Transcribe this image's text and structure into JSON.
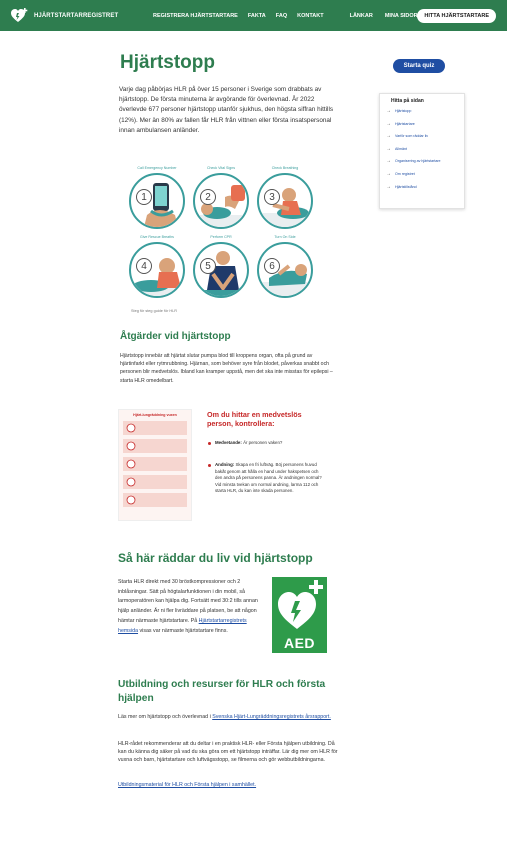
{
  "header": {
    "logo_text": "HJÄRTSTARTARREGISTRET",
    "nav": [
      "REGISTRERA HJÄRTSTARTARE",
      "FAKTA",
      "FAQ",
      "KONTAKT",
      "LÄNKAR",
      "MINA SIDOR"
    ],
    "find_button": "HITTA HJÄRTSTARTARE"
  },
  "page": {
    "title": "Hjärtstopp",
    "quiz_button": "Starta quiz",
    "intro": "Varje dag påbörjas HLR på över 15 personer i Sverige som drabbats av hjärtstopp. De första minuterna är avgörande för överlevnad. År 2022 överlevde 677 personer hjärtstopp utanför sjukhus, den högsta siffran hittills (12%). Mer än 80% av fallen får HLR från vittnen eller första insatspersonal innan ambulansen anländer."
  },
  "toc": {
    "title": "Hitta på sidan",
    "items": [
      "Hjärtstopp",
      "Hjärtstartare",
      "Varför som räddar liv",
      "Allmänt",
      "Organisering av hjärtstartare",
      "Om registret",
      "Hjärtstillstånd"
    ]
  },
  "steps": {
    "items": [
      {
        "label": "Call Emergency Number",
        "num": "1"
      },
      {
        "label": "Check Vital Signs",
        "num": "2"
      },
      {
        "label": "Check Breathing",
        "num": "3"
      },
      {
        "label": "Give Rescue Breaths",
        "num": "4"
      },
      {
        "label": "Perform CPR",
        "num": "5"
      },
      {
        "label": "Turn On Side",
        "num": "6"
      }
    ],
    "caption": "Steg för steg guide för HLR"
  },
  "section1": {
    "heading": "Åtgärder vid hjärtstopp",
    "text": "Hjärtstopp innebär att hjärtat slutar pumpa blod till kroppens organ, ofta på grund av hjärtinfarkt eller rytmrubbning. Hjärnan, som behöver syre från blodet, påverkas snabbt och personen blir medvetslös. Ibland kan kramper uppstå, men det ska inte misstas för epilepsi – starta HLR omedelbart."
  },
  "check": {
    "poster_title": "Hjärt-lungräddning vuxen",
    "title": "Om du hittar en medvetslös person, kontrollera:",
    "bullets": [
      {
        "label": "Medvetande:",
        "text": " Är personen vaken?"
      },
      {
        "label": "Andning:",
        "text": " Skapa en fri luftväg. Böj personens huvud bakåt genom att hålla en hand under hakspetsen och den andra på personens panna. Är andningen normal? Vid minsta tvekan om normal andning, larma 112 och starta HLR, du kan inte skada personen."
      }
    ]
  },
  "section2": {
    "heading": "Så här räddar du liv vid hjärtstopp",
    "text": "Starta HLR direkt med 30 bröstkompressioner och 2 inblåsningar. Sätt på högtalarfunktionen i din mobil, så larmoperatören kan hjälpa dig. Fortsätt med 30:2 tills annan hjälp anländer. Är ni fler livräddare på platsen, be att någon hämtar närmaste hjärtstartare. På ",
    "link": "Hjärtstartarregistrets hemsida",
    "text_after": " visas var närmaste hjärtstartare finns.",
    "aed_label": "AED"
  },
  "section3": {
    "heading": "Utbildning och resurser för HLR och första hjälpen",
    "p1_text": "Läs mer om hjärtstopp och överlevnad i ",
    "p1_link": "Svenska Hjärt-Lungräddningsregistrets årsrapport.",
    "p2": "HLR-rådet rekommenderar att du deltar i en praktisk HLR- eller Första hjälpen utbildning. Då kan du känna dig säker på vad du ska göra om ett hjärtstopp inträffar. Lär dig mer om HLR för vuxna och barn, hjärtstartare och luftvägsstopp, se filmerna och gör webbutbildningarna.",
    "p3_link": "Utbildningsmaterial för HLR och Första hjälpen i samhället."
  },
  "colors": {
    "brand_green": "#2e7d4f",
    "link_blue": "#1f4ea3",
    "alert_red": "#c62828",
    "teal": "#3a9d9c"
  }
}
